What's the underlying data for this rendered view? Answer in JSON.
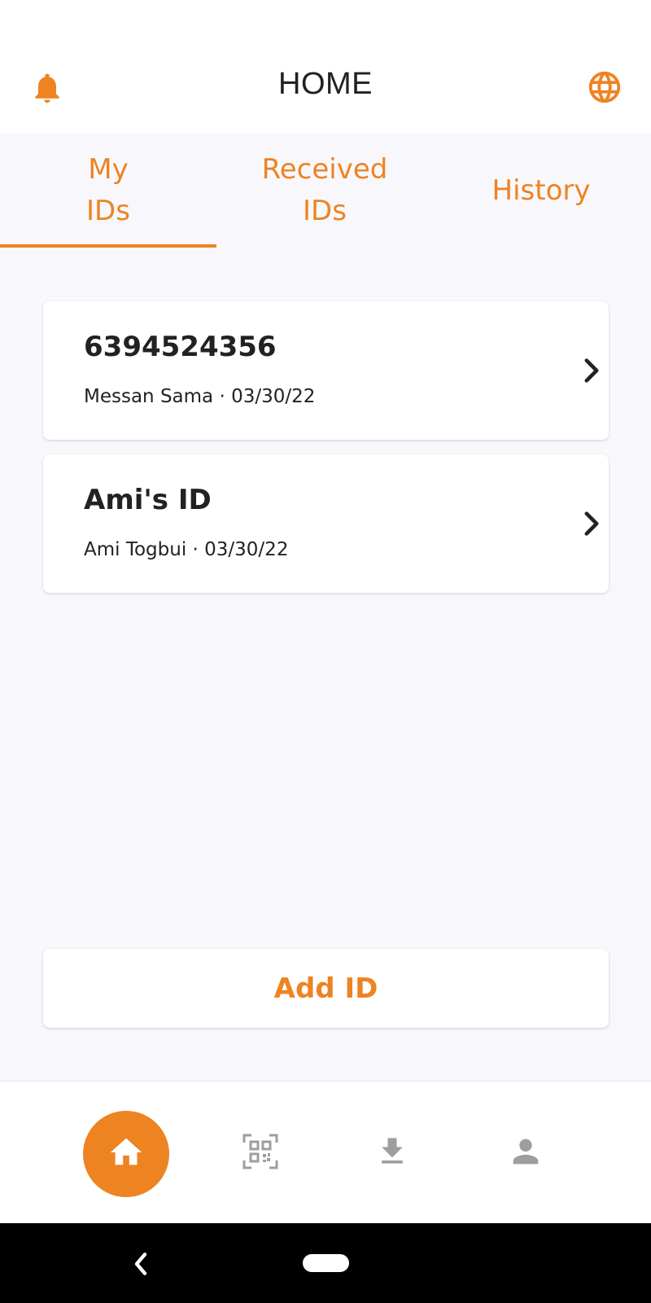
{
  "app_bar": {
    "title": "HOME",
    "left_icon": "bell-icon",
    "right_icon": "globe-icon"
  },
  "tabs": [
    {
      "label_line1": "My",
      "label_line2": "IDs",
      "selected": true
    },
    {
      "label_line1": "Received",
      "label_line2": "IDs",
      "selected": false
    },
    {
      "label_line1": "History",
      "label_line2": "",
      "selected": false
    }
  ],
  "ids": [
    {
      "name": "6394524356",
      "meta": "Messan Sama · 03/30/22"
    },
    {
      "name": "Ami's ID",
      "meta": "Ami Togbui · 03/30/22"
    }
  ],
  "add_button": {
    "label": "Add ID"
  },
  "bottom_nav": {
    "items": [
      {
        "icon": "home-icon",
        "active": true
      },
      {
        "icon": "qr-code-icon",
        "active": false
      },
      {
        "icon": "download-icon",
        "active": false
      },
      {
        "icon": "person-icon",
        "active": false
      }
    ]
  },
  "colors": {
    "accent": "#EE8322",
    "background": "#F8F8FC",
    "text": "#212121",
    "inactive_icon": "#9E9E9E"
  }
}
